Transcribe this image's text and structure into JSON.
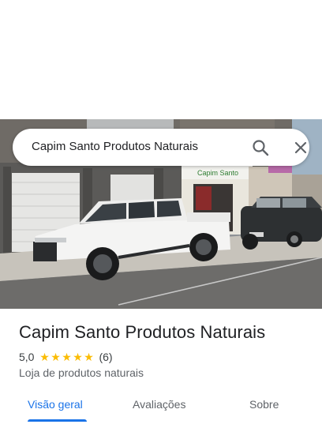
{
  "search": {
    "query": "Capim Santo Produtos Naturais"
  },
  "place": {
    "name": "Capim Santo Produtos Naturais",
    "rating": "5,0",
    "stars": 5,
    "review_count": "(6)",
    "category": "Loja de produtos naturais"
  },
  "photo": {
    "store_sign": "Capim Santo"
  },
  "tabs": [
    {
      "label": "Visão geral",
      "active": true
    },
    {
      "label": "Avaliações",
      "active": false
    },
    {
      "label": "Sobre",
      "active": false
    }
  ],
  "colors": {
    "accent": "#1a73e8",
    "star": "#fbbc04",
    "text_primary": "#202124",
    "text_secondary": "#5f6368"
  },
  "icons": {
    "search": "search-icon",
    "close": "close-icon",
    "star": "star-icon"
  }
}
